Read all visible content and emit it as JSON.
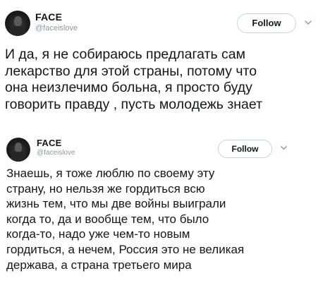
{
  "tweets": [
    {
      "user": {
        "name": "FACE",
        "handle": "@faceislove"
      },
      "follow_label": "Follow",
      "text": "И да, я не собираюсь предлагать сам\nлекарство для этой страны, потому что\nона неизлечимо больна, я просто буду\nговорить правду , пусть молодежь знает"
    },
    {
      "user": {
        "name": "FACE",
        "handle": "@faceislove"
      },
      "follow_label": "Follow",
      "text": "Знаешь, я тоже люблю по своему эту\nстрану, но нельзя же гордиться  всю\nжизнь тем, что мы две войны выиграли\nкогда то, да и вообще тем, что было\nкогда-то, надо уже чем-то новым\nгордиться, а нечем, Россия это не великая\nдержава, а страна третьего мира"
    }
  ],
  "icons": {
    "more": "chevron-down-icon"
  },
  "colors": {
    "text": "#14171a",
    "handle": "#8899a6",
    "button_border": "#c8d4dd"
  }
}
